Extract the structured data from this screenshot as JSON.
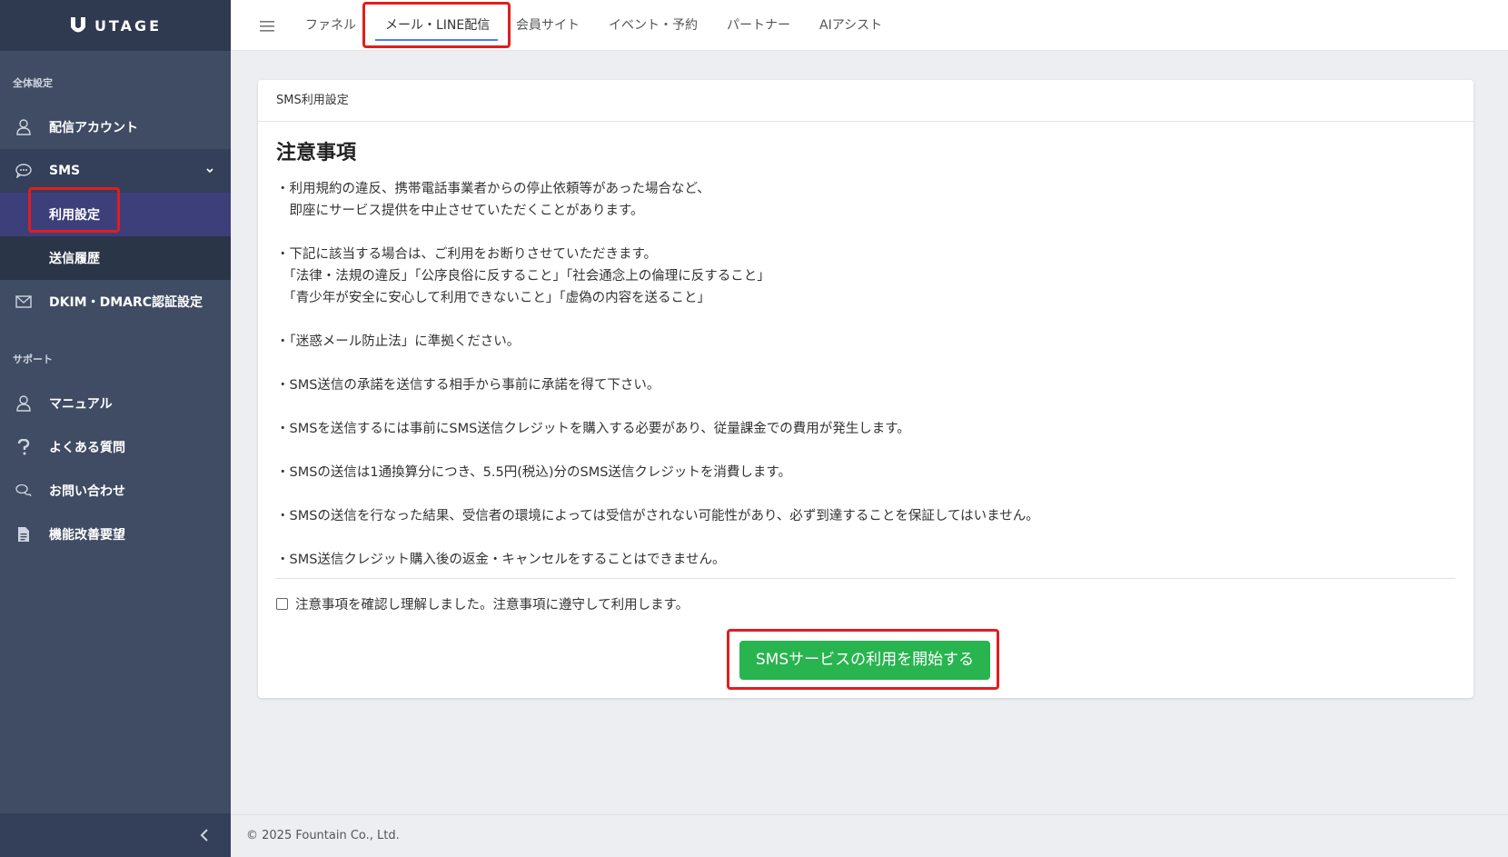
{
  "brand": {
    "name": "UTAGE"
  },
  "sidebar": {
    "section_general": "全体設定",
    "items": [
      {
        "label": "配信アカウント",
        "icon": "user-icon"
      },
      {
        "label": "SMS",
        "icon": "chat-icon"
      },
      {
        "label": "DKIM・DMARC認証設定",
        "icon": "mail-icon"
      }
    ],
    "sms_sub": [
      {
        "label": "利用設定",
        "active": true
      },
      {
        "label": "送信履歴",
        "active": false
      }
    ],
    "section_support": "サポート",
    "support_items": [
      {
        "label": "マニュアル",
        "icon": "user-icon"
      },
      {
        "label": "よくある質問",
        "icon": "question-icon"
      },
      {
        "label": "お問い合わせ",
        "icon": "chat-bubbles-icon"
      },
      {
        "label": "機能改善要望",
        "icon": "document-icon"
      }
    ]
  },
  "topbar": {
    "tabs": [
      {
        "label": "ファネル"
      },
      {
        "label": "メール・LINE配信",
        "active": true
      },
      {
        "label": "会員サイト"
      },
      {
        "label": "イベント・予約"
      },
      {
        "label": "パートナー"
      },
      {
        "label": "AIアシスト"
      }
    ]
  },
  "card": {
    "header": "SMS利用設定",
    "title": "注意事項",
    "notices": [
      "・利用規約の違反、携帯電話事業者からの停止依頼等があった場合など、\n　即座にサービス提供を中止させていただくことがあります。",
      "・下記に該当する場合は、ご利用をお断りさせていただきます。\n　「法律・法規の違反」「公序良俗に反すること」「社会通念上の倫理に反すること」\n　「青少年が安全に安心して利用できないこと」「虚偽の内容を送ること」",
      "・「迷惑メール防止法」に準拠ください。",
      "・SMS送信の承諾を送信する相手から事前に承諾を得て下さい。",
      "・SMSを送信するには事前にSMS送信クレジットを購入する必要があり、従量課金での費用が発生します。",
      "・SMSの送信は1通換算分につき、5.5円(税込)分のSMS送信クレジットを消費します。",
      "・SMSの送信を行なった結果、受信者の環境によっては受信がされない可能性があり、必ず到達することを保証してはいません。",
      "・SMS送信クレジット購入後の返金・キャンセルをすることはできません。"
    ],
    "agree_label": "注意事項を確認し理解しました。注意事項に遵守して利用します。",
    "agree_checked": false,
    "start_button": "SMSサービスの利用を開始する"
  },
  "footer": {
    "copyright": "© 2025 Fountain Co., Ltd."
  },
  "colors": {
    "sidebar": "#3f4c63",
    "accent_green": "#28b44f",
    "highlight_red": "#e01e1e",
    "tab_underline": "#4a7ff0"
  }
}
